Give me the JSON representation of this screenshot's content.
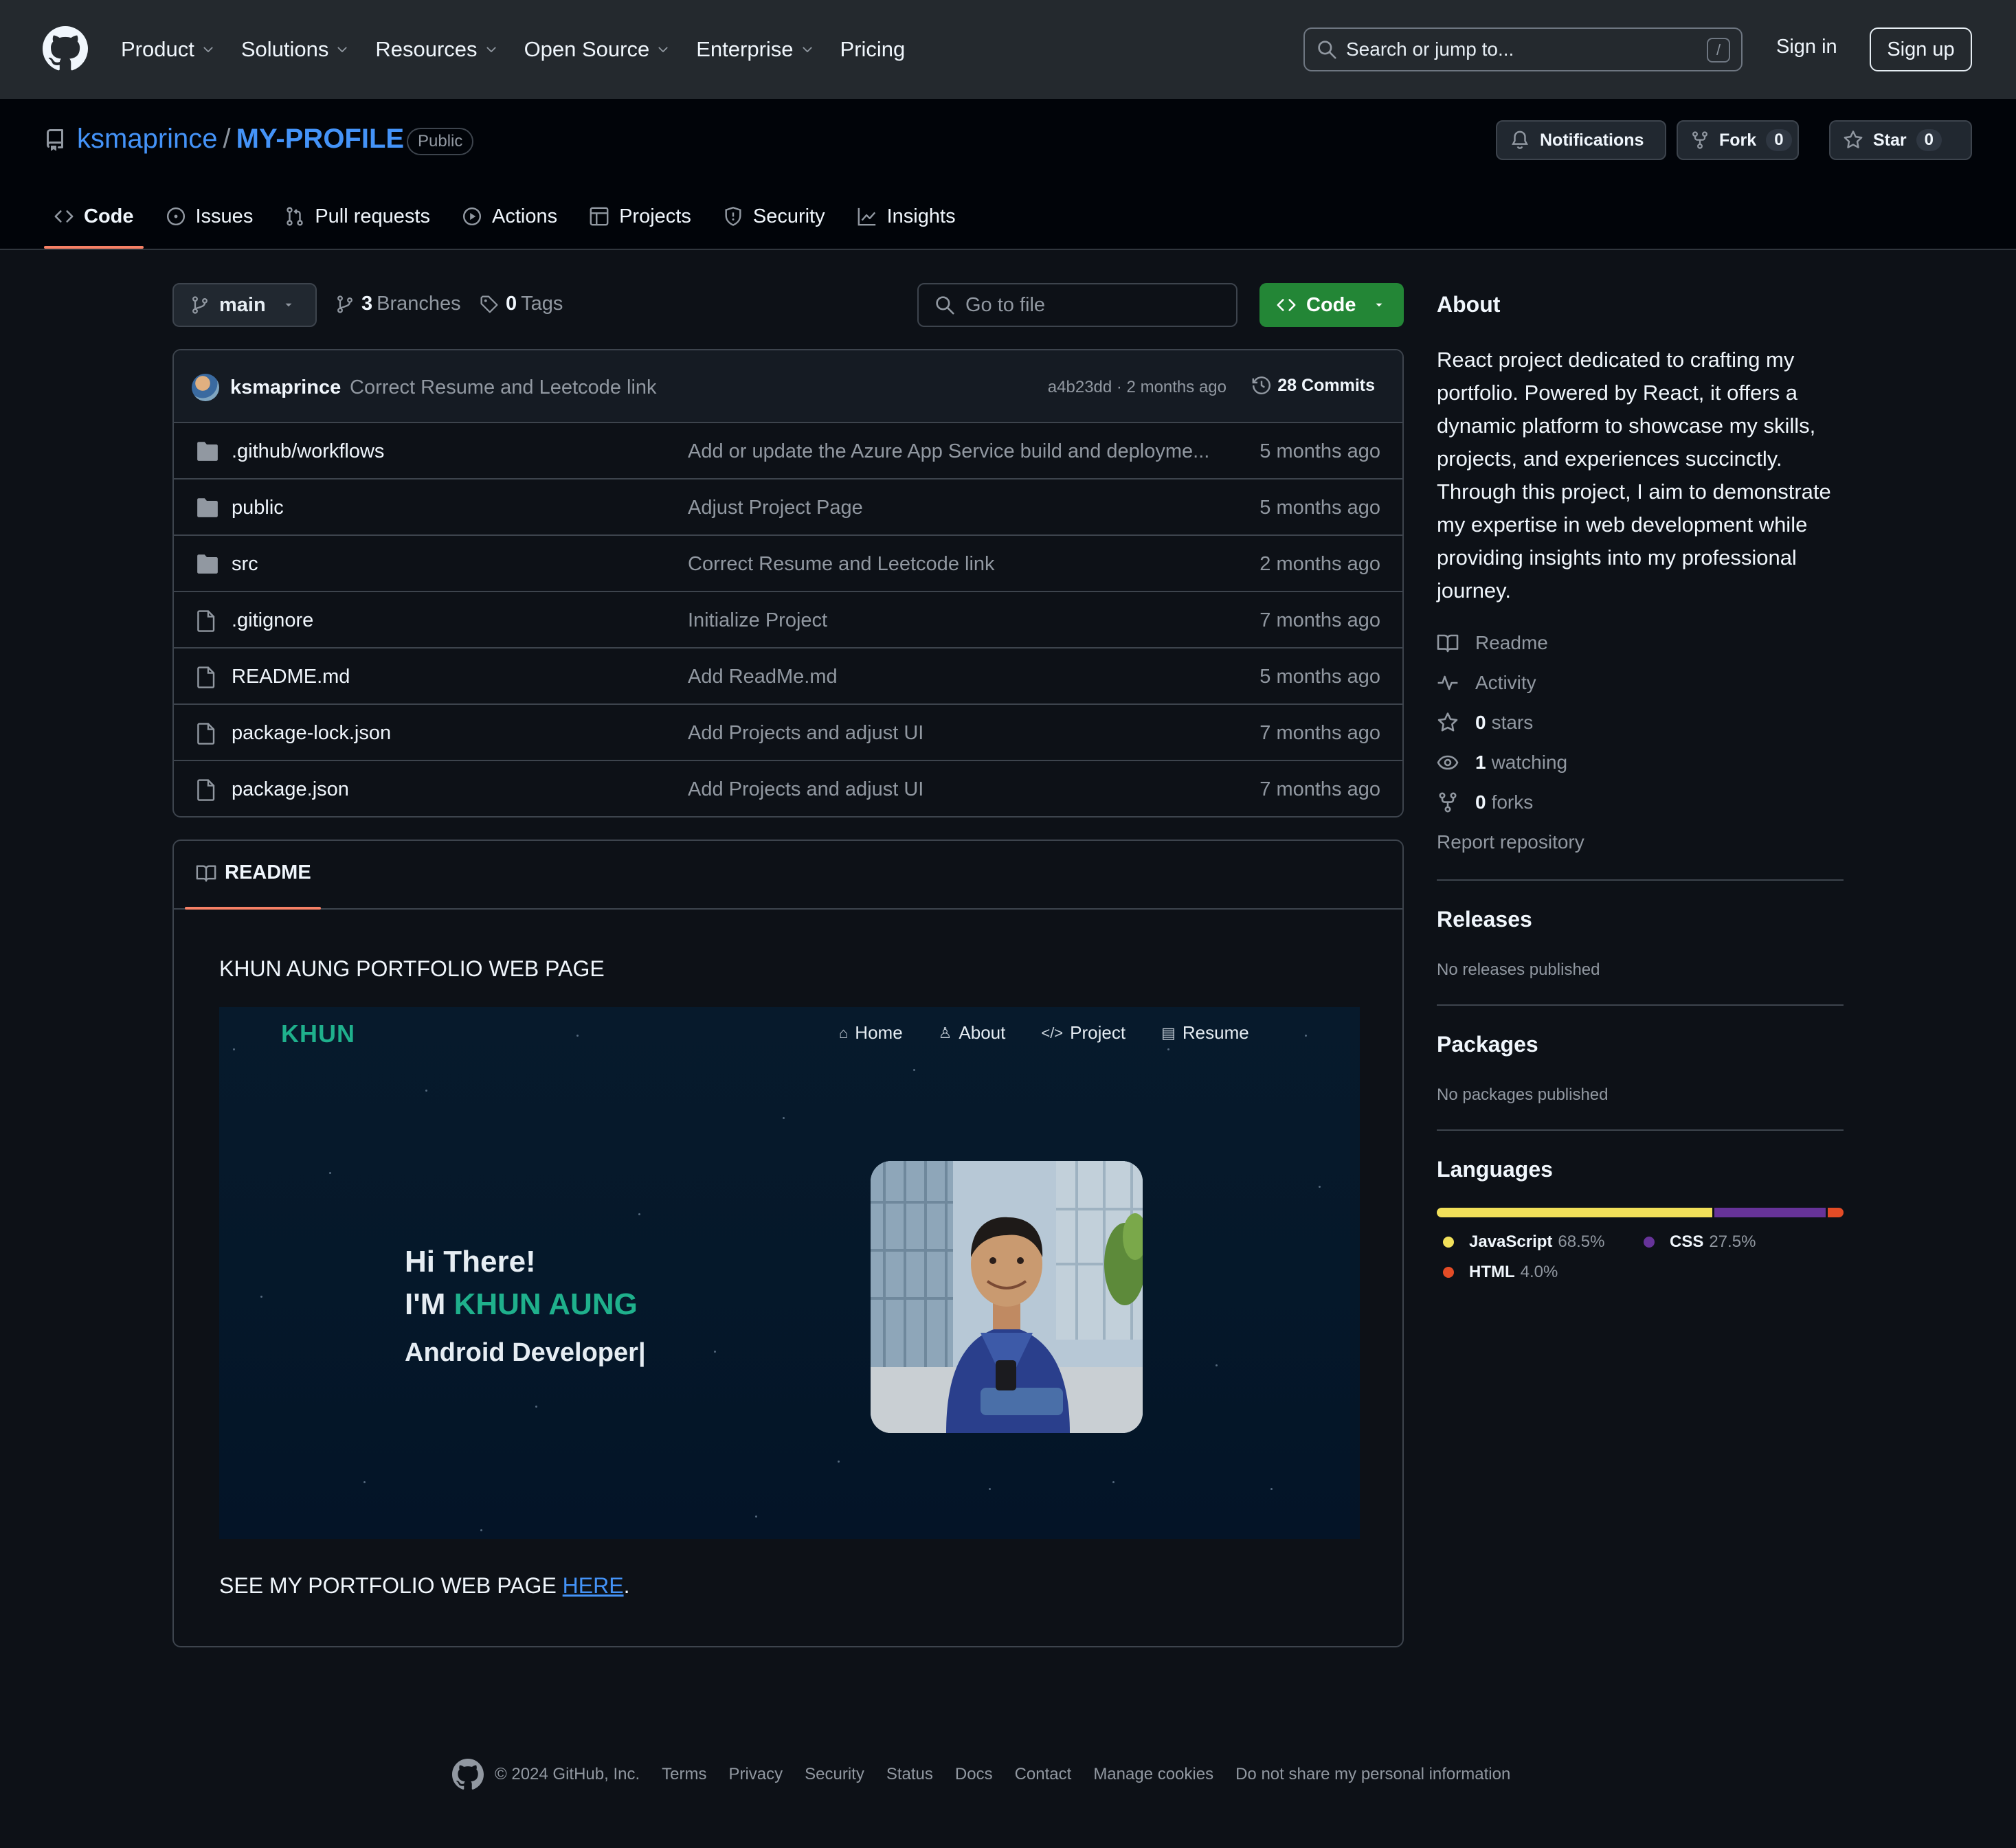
{
  "header": {
    "nav": [
      "Product",
      "Solutions",
      "Resources",
      "Open Source",
      "Enterprise",
      "Pricing"
    ],
    "nav_has_dropdown": [
      true,
      true,
      true,
      true,
      true,
      false
    ],
    "search_placeholder": "Search or jump to...",
    "search_shortcut": "/",
    "signin": "Sign in",
    "signup": "Sign up"
  },
  "repo": {
    "owner": "ksmaprince",
    "separator": "/",
    "name": "MY-PROFILE",
    "visibility": "Public",
    "notifications_label": "Notifications",
    "fork_label": "Fork",
    "fork_count": "0",
    "star_label": "Star",
    "star_count": "0"
  },
  "tabs": [
    "Code",
    "Issues",
    "Pull requests",
    "Actions",
    "Projects",
    "Security",
    "Insights"
  ],
  "toolbar": {
    "branch": "main",
    "branches_count": "3",
    "branches_label": "Branches",
    "tags_count": "0",
    "tags_label": "Tags",
    "goto_placeholder": "Go to file",
    "code_label": "Code"
  },
  "latest_commit": {
    "user": "ksmaprince",
    "message": "Correct Resume and Leetcode link",
    "hash_time": "a4b23dd · 2 months ago",
    "commits": "28 Commits"
  },
  "files": [
    {
      "type": "dir",
      "name": ".github/workflows",
      "message": "Add or update the Azure App Service build and deployme...",
      "age": "5 months ago"
    },
    {
      "type": "dir",
      "name": "public",
      "message": "Adjust Project Page",
      "age": "5 months ago"
    },
    {
      "type": "dir",
      "name": "src",
      "message": "Correct Resume and Leetcode link",
      "age": "2 months ago"
    },
    {
      "type": "file",
      "name": ".gitignore",
      "message": "Initialize Project",
      "age": "7 months ago"
    },
    {
      "type": "file",
      "name": "README.md",
      "message": "Add ReadMe.md",
      "age": "5 months ago"
    },
    {
      "type": "file",
      "name": "package-lock.json",
      "message": "Add Projects and adjust UI",
      "age": "7 months ago"
    },
    {
      "type": "file",
      "name": "package.json",
      "message": "Add Projects and adjust UI",
      "age": "7 months ago"
    }
  ],
  "readme": {
    "tab": "README",
    "title": "KHUN AUNG PORTFOLIO WEB PAGE",
    "preview": {
      "brand": "KHUN",
      "nav": [
        "Home",
        "About",
        "Project",
        "Resume"
      ],
      "greeting": "Hi There!",
      "im": "I'M",
      "name": "KHUN AUNG",
      "role": "Android Developer|"
    },
    "footer_text": "SEE MY PORTFOLIO WEB PAGE",
    "footer_link": "HERE",
    "footer_end": "."
  },
  "about": {
    "heading": "About",
    "description": "React project dedicated to crafting my portfolio. Powered by React, it offers a dynamic platform to showcase my skills, projects, and experiences succinctly. Through this project, I aim to demonstrate my expertise in web development while providing insights into my professional journey.",
    "readme": "Readme",
    "activity": "Activity",
    "stars_count": "0",
    "stars_label": "stars",
    "watching_count": "1",
    "watching_label": "watching",
    "forks_count": "0",
    "forks_label": "forks",
    "report": "Report repository"
  },
  "releases": {
    "heading": "Releases",
    "text": "No releases published"
  },
  "packages": {
    "heading": "Packages",
    "text": "No packages published"
  },
  "languages": {
    "heading": "Languages",
    "items": [
      {
        "name": "JavaScript",
        "percent": "68.5%",
        "value": 68.5,
        "color": "#f1e05a"
      },
      {
        "name": "CSS",
        "percent": "27.5%",
        "value": 27.5,
        "color": "#663399"
      },
      {
        "name": "HTML",
        "percent": "4.0%",
        "value": 4.0,
        "color": "#e34c26"
      }
    ]
  },
  "footer": {
    "copyright": "© 2024 GitHub, Inc.",
    "links": [
      "Terms",
      "Privacy",
      "Security",
      "Status",
      "Docs",
      "Contact",
      "Manage cookies",
      "Do not share my personal information"
    ]
  }
}
